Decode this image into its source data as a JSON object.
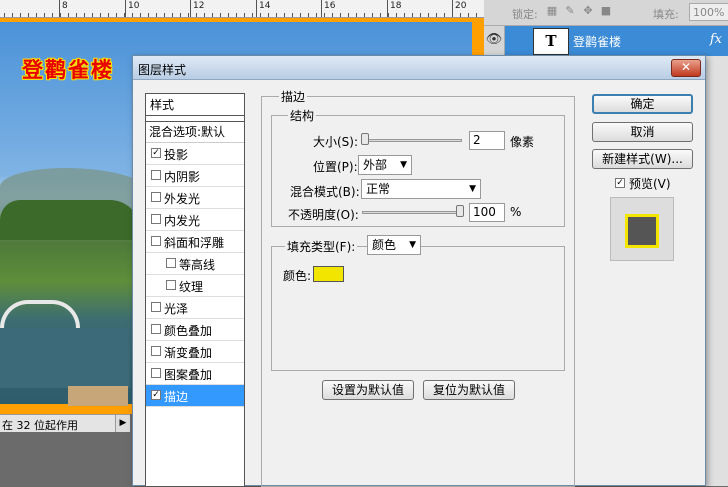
{
  "ruler": {
    "labels": [
      "8",
      "10",
      "12",
      "14",
      "16",
      "18",
      "20"
    ]
  },
  "canvas": {
    "title_text": "登鹳雀楼",
    "frame_color": "#ff9f00"
  },
  "statusbar": {
    "text": "在 32 位起作用"
  },
  "layers_panel": {
    "lock_label": "锁定:",
    "fill_label": "填充:",
    "fill_value": "100%",
    "layer_name": "登鹳雀楼",
    "layer_thumb_glyph": "T",
    "fx_label": "fx"
  },
  "dialog": {
    "title": "图层样式",
    "close_glyph": "✕",
    "styles_header": "样式",
    "blend_options": "混合选项:默认",
    "style_items": [
      {
        "label": "投影",
        "checked": true,
        "indent": false,
        "active": false
      },
      {
        "label": "内阴影",
        "checked": false,
        "indent": false,
        "active": false
      },
      {
        "label": "外发光",
        "checked": false,
        "indent": false,
        "active": false
      },
      {
        "label": "内发光",
        "checked": false,
        "indent": false,
        "active": false
      },
      {
        "label": "斜面和浮雕",
        "checked": false,
        "indent": false,
        "active": false
      },
      {
        "label": "等高线",
        "checked": false,
        "indent": true,
        "active": false
      },
      {
        "label": "纹理",
        "checked": false,
        "indent": true,
        "active": false
      },
      {
        "label": "光泽",
        "checked": false,
        "indent": false,
        "active": false
      },
      {
        "label": "颜色叠加",
        "checked": false,
        "indent": false,
        "active": false
      },
      {
        "label": "渐变叠加",
        "checked": false,
        "indent": false,
        "active": false
      },
      {
        "label": "图案叠加",
        "checked": false,
        "indent": false,
        "active": false
      },
      {
        "label": "描边",
        "checked": true,
        "indent": false,
        "active": true
      }
    ],
    "stroke": {
      "section_title": "描边",
      "structure_title": "结构",
      "size_label": "大小(S):",
      "size_value": "2",
      "size_unit": "像素",
      "position_label": "位置(P):",
      "position_value": "外部",
      "blend_mode_label": "混合模式(B):",
      "blend_mode_value": "正常",
      "opacity_label": "不透明度(O):",
      "opacity_value": "100",
      "opacity_unit": "%",
      "fill_type_label": "填充类型(F):",
      "fill_type_value": "颜色",
      "color_label": "颜色:",
      "color_value": "#f2e600"
    },
    "buttons": {
      "ok": "确定",
      "cancel": "取消",
      "new_style": "新建样式(W)...",
      "preview_label": "预览(V)",
      "preview_checked": true,
      "make_default": "设置为默认值",
      "reset_default": "复位为默认值"
    }
  }
}
